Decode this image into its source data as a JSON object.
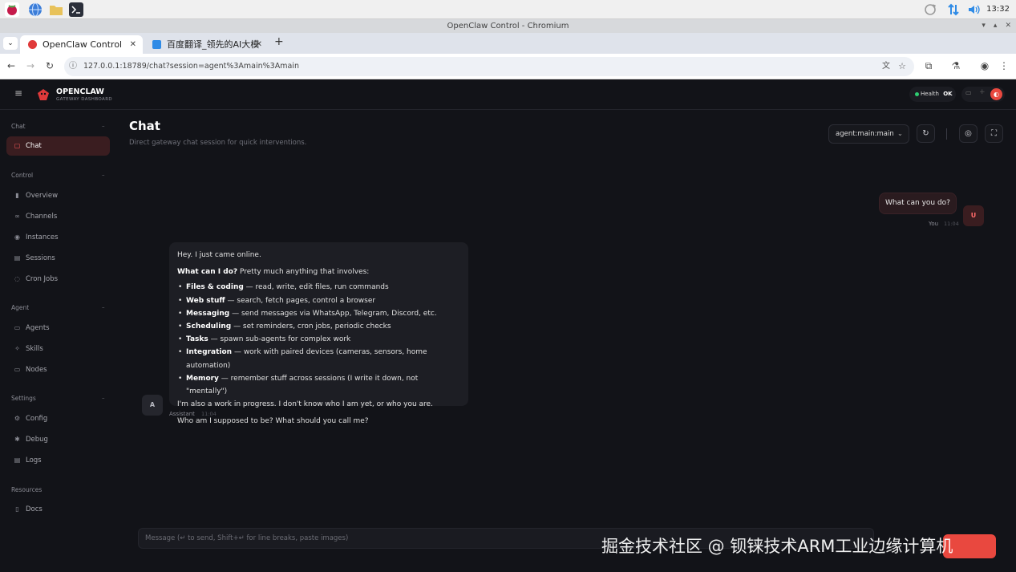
{
  "os": {
    "clock": "13:32",
    "icons": [
      "raspberry-icon",
      "globe-icon",
      "folder-icon",
      "terminal-icon"
    ],
    "tray_icons": [
      "sync-icon",
      "network-icon",
      "volume-icon"
    ]
  },
  "window": {
    "title": "OpenClaw Control - Chromium"
  },
  "tabs": [
    {
      "label": "OpenClaw Control",
      "active": true
    },
    {
      "label": "百度翻译_领先的AI大模",
      "active": false
    }
  ],
  "address": {
    "url": "127.0.0.1:18789/chat?session=agent%3Amain%3Amain"
  },
  "brand": {
    "name": "OPENCLAW",
    "subtitle": "GATEWAY DASHBOARD"
  },
  "health": {
    "label": "Health",
    "status": "OK"
  },
  "sidebar": {
    "sections": [
      {
        "title": "Chat",
        "items": [
          {
            "label": "Chat",
            "icon": "chat-icon",
            "active": true
          }
        ]
      },
      {
        "title": "Control",
        "items": [
          {
            "label": "Overview",
            "icon": "bar-chart-icon"
          },
          {
            "label": "Channels",
            "icon": "link-icon"
          },
          {
            "label": "Instances",
            "icon": "radio-icon"
          },
          {
            "label": "Sessions",
            "icon": "document-icon"
          },
          {
            "label": "Cron Jobs",
            "icon": "clock-icon"
          }
        ]
      },
      {
        "title": "Agent",
        "items": [
          {
            "label": "Agents",
            "icon": "folder-icon"
          },
          {
            "label": "Skills",
            "icon": "sparkle-icon"
          },
          {
            "label": "Nodes",
            "icon": "monitor-icon"
          }
        ]
      },
      {
        "title": "Settings",
        "items": [
          {
            "label": "Config",
            "icon": "gear-icon"
          },
          {
            "label": "Debug",
            "icon": "bug-icon"
          },
          {
            "label": "Logs",
            "icon": "list-icon"
          }
        ]
      },
      {
        "title": "Resources",
        "items": [
          {
            "label": "Docs",
            "icon": "book-icon"
          }
        ]
      }
    ]
  },
  "main": {
    "title": "Chat",
    "subtitle": "Direct gateway chat session for quick interventions.",
    "session_select": "agent:main:main"
  },
  "messages": {
    "user": {
      "text": "What can you do?",
      "sender": "You",
      "time": "11:04",
      "avatar": "U"
    },
    "assistant": {
      "avatar": "A",
      "sender": "Assistant",
      "time": "11:04",
      "greeting": "Hey. I just came online.",
      "intro_bold": "What can I do?",
      "intro_rest": " Pretty much anything that involves:",
      "bullets": [
        {
          "bold": "Files & coding",
          "rest": " — read, write, edit files, run commands"
        },
        {
          "bold": "Web stuff",
          "rest": " — search, fetch pages, control a browser"
        },
        {
          "bold": "Messaging",
          "rest": " — send messages via WhatsApp, Telegram, Discord, etc."
        },
        {
          "bold": "Scheduling",
          "rest": " — set reminders, cron jobs, periodic checks"
        },
        {
          "bold": "Tasks",
          "rest": " — spawn sub-agents for complex work"
        },
        {
          "bold": "Integration",
          "rest": " — work with paired devices (cameras, sensors, home automation)"
        },
        {
          "bold": "Memory",
          "rest": " — remember stuff across sessions (I write it down, not \"mentally\")"
        }
      ],
      "wip": "I'm also a work in progress. I don't know who I am yet, or who you are.",
      "question": "Who am I supposed to be? What should you call me?"
    }
  },
  "composer": {
    "placeholder": "Message (↵ to send, Shift+↵ for line breaks, paste images)"
  },
  "watermark": "掘金技术社区 @ 钡铼技术ARM工业边缘计算机"
}
